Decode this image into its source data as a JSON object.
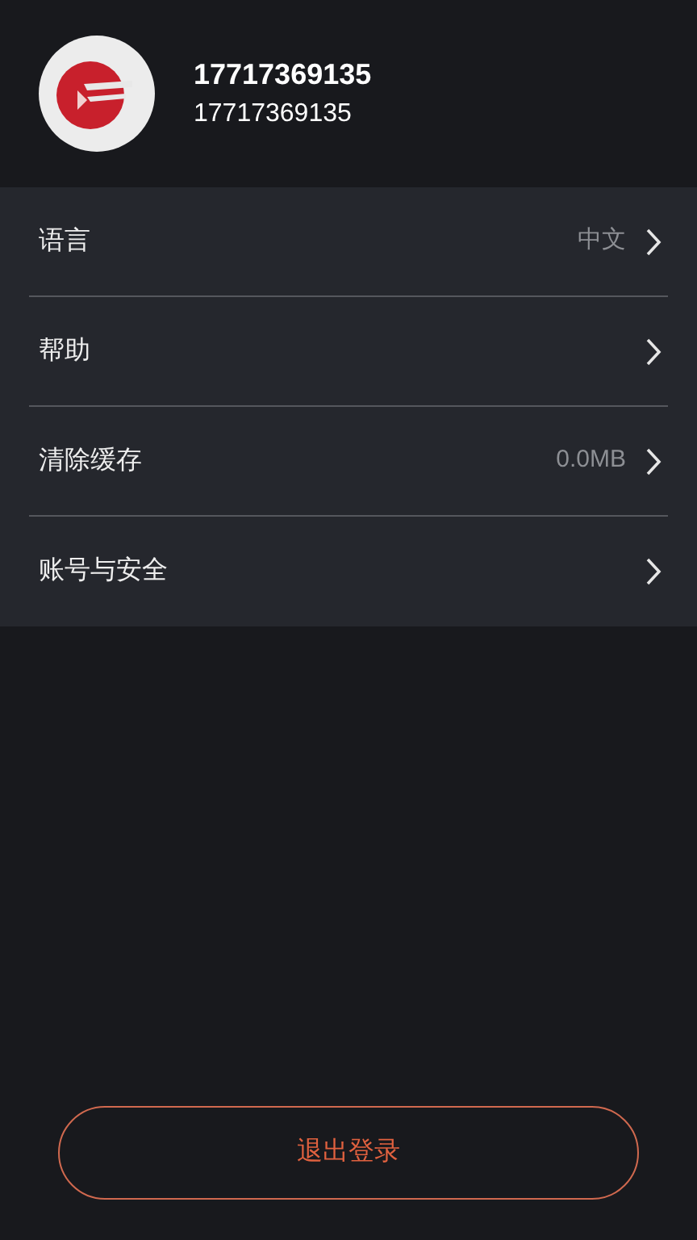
{
  "profile": {
    "name": "17717369135",
    "account": "17717369135"
  },
  "settings": [
    {
      "label": "语言",
      "value": "中文"
    },
    {
      "label": "帮助"
    },
    {
      "label": "清除缓存",
      "value": "0.0MB"
    },
    {
      "label": "账号与安全"
    }
  ],
  "logout_button": "退出登录"
}
